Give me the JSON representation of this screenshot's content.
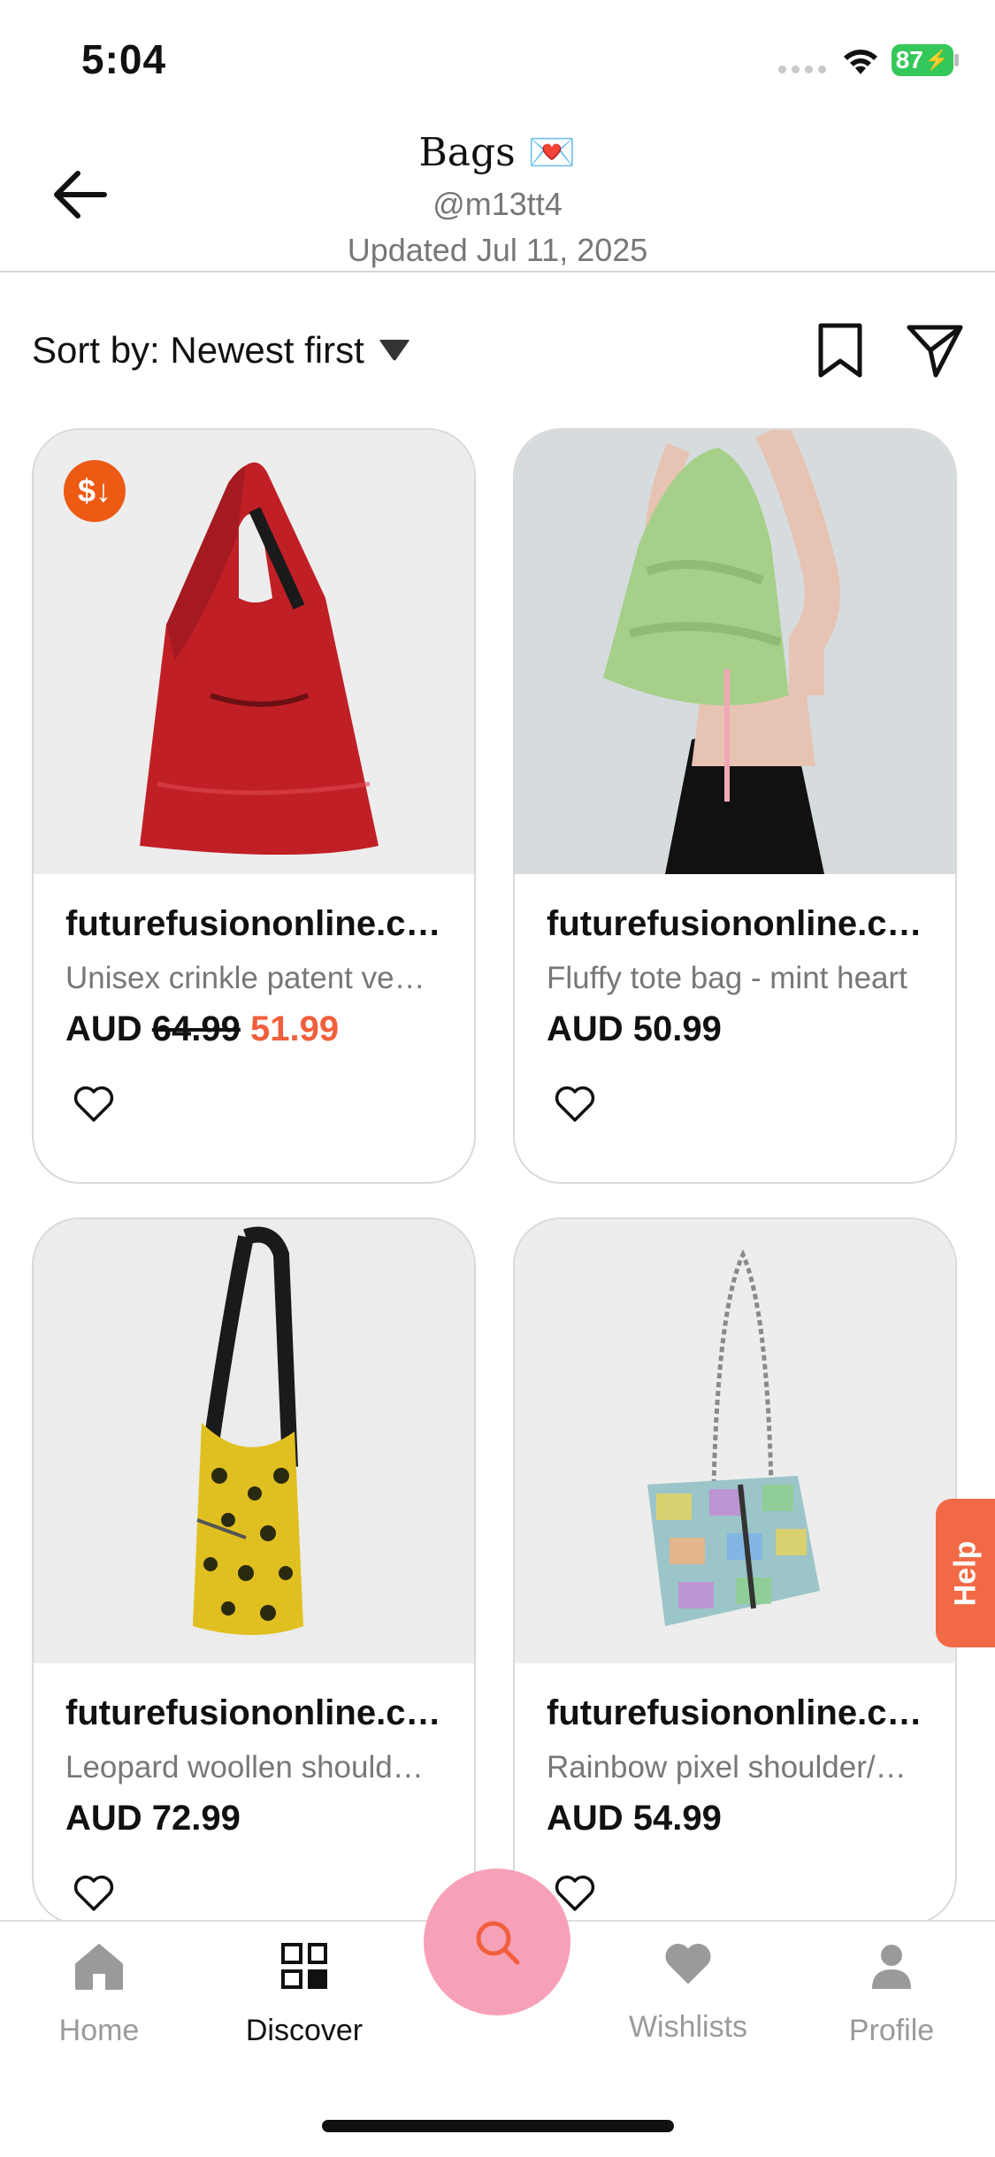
{
  "status_bar": {
    "time": "5:04",
    "battery": "87"
  },
  "header": {
    "title": "Bags 💌",
    "handle": "@m13tt4",
    "updated": "Updated Jul 11, 2025"
  },
  "toolbar": {
    "sort_label": "Sort by: Newest first"
  },
  "products": [
    {
      "store": "futurefusiononline.com.au",
      "description": "Unisex crinkle patent vegan leather tote",
      "price_prefix": "AUD",
      "old_price": "64.99",
      "sale_price": "51.99",
      "badge": "$↓"
    },
    {
      "store": "futurefusiononline.com.au",
      "description": "Fluffy tote bag - mint heart",
      "price": "AUD 50.99"
    },
    {
      "store": "futurefusiononline.com.au",
      "description": "Leopard woollen shoulder bag",
      "price": "AUD 72.99"
    },
    {
      "store": "futurefusiononline.com.au",
      "description": "Rainbow pixel shoulder/crossbody bag",
      "price": "AUD 54.99"
    }
  ],
  "help_label": "Help",
  "nav": {
    "home": "Home",
    "discover": "Discover",
    "wishlists": "Wishlists",
    "profile": "Profile"
  },
  "colors": {
    "accent": "#f05f3c",
    "fab": "#f7a1b8",
    "badge": "#ec5a14",
    "help": "#f26a45"
  }
}
